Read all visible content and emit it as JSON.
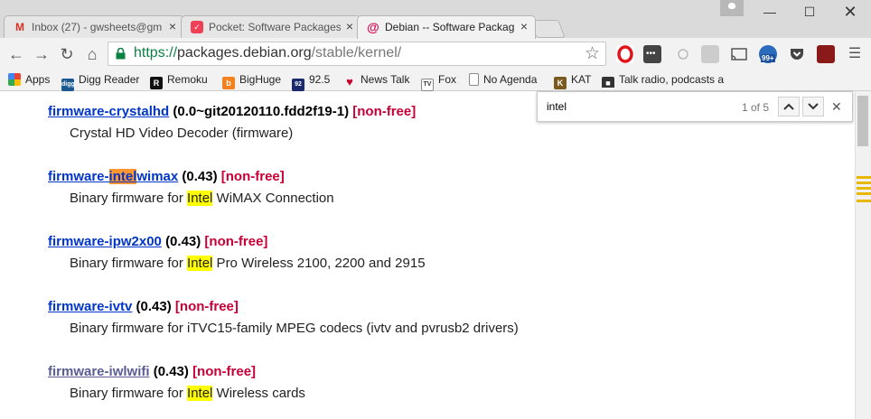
{
  "tabs": [
    {
      "title": "Inbox (27) - gwsheets@gm",
      "icon": "gmail-icon"
    },
    {
      "title": "Pocket: Software Packages",
      "icon": "pocket-icon"
    },
    {
      "title": "Debian -- Software Packag",
      "icon": "debian-icon",
      "active": true
    }
  ],
  "url": {
    "scheme": "https://",
    "host": "packages.debian.org",
    "path": "/stable/kernel/"
  },
  "bookmarks": [
    {
      "label": "Apps",
      "icon": "apps-icon",
      "color": "#4285f4"
    },
    {
      "label": "Digg Reader",
      "icon": "digg-icon",
      "color": "#1b5891",
      "glyph": "digg"
    },
    {
      "label": "Remoku",
      "icon": "remoku-icon",
      "color": "#111111",
      "glyph": "R"
    },
    {
      "label": "BigHuge",
      "icon": "bighuge-icon",
      "color": "#f4821f",
      "glyph": "b"
    },
    {
      "label": "92.5",
      "icon": "radio-925-icon",
      "color": "#1a2a6c",
      "glyph": "92"
    },
    {
      "label": "News Talk",
      "icon": "iheart-icon",
      "color": "#c6002b",
      "glyph": "♥"
    },
    {
      "label": "Fox",
      "icon": "tv-icon",
      "color": "#555555",
      "glyph": "TV"
    },
    {
      "label": "No Agenda",
      "icon": "page-icon",
      "color": "#ffffff",
      "glyph": ""
    },
    {
      "label": "KAT",
      "icon": "kat-icon",
      "color": "#7a5a1e",
      "glyph": "K"
    },
    {
      "label": "Talk radio, podcasts ar",
      "icon": "talk-radio-icon",
      "color": "#333333",
      "glyph": "■"
    }
  ],
  "find": {
    "query": "intel",
    "count": "1 of 5"
  },
  "packages": [
    {
      "name": "firmware-crystalhd",
      "version": "(0.0~git20120110.fdd2f19-1)",
      "license": "[non-free]",
      "desc": "Crystal HD Video Decoder (firmware)"
    },
    {
      "name_pre": "firmware-",
      "name_hl": "intel",
      "name_post": "wimax",
      "version": "(0.43)",
      "license": "[non-free]",
      "desc_pre": "Binary firmware for ",
      "desc_hl": "Intel",
      "desc_post": " WiMAX Connection"
    },
    {
      "name": "firmware-ipw2x00",
      "version": "(0.43)",
      "license": "[non-free]",
      "desc_pre": "Binary firmware for ",
      "desc_hl": "Intel",
      "desc_post": " Pro Wireless 2100, 2200 and 2915"
    },
    {
      "name": "firmware-ivtv",
      "version": "(0.43)",
      "license": "[non-free]",
      "desc": "Binary firmware for iTVC15-family MPEG codecs (ivtv and pvrusb2 drivers)"
    },
    {
      "name": "firmware-iwlwifi",
      "version": "(0.43)",
      "license": "[non-free]",
      "desc_pre": "Binary firmware for ",
      "desc_hl": "Intel",
      "desc_post": " Wireless cards"
    }
  ],
  "badge": "99+"
}
